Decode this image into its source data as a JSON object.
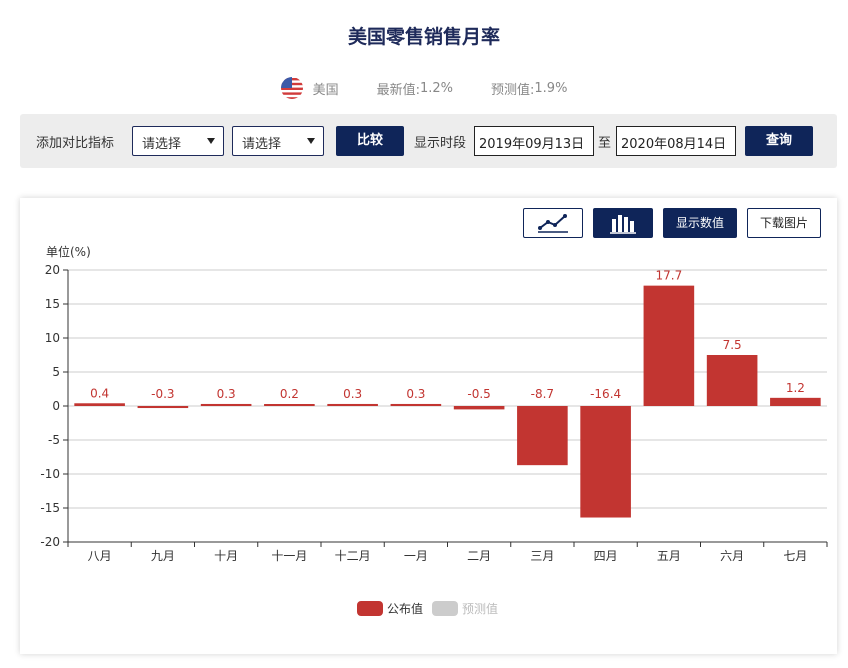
{
  "page": {
    "title": "美国零售销售月率"
  },
  "info": {
    "country": "美国",
    "latest_label": "最新值:",
    "latest_value": "1.2%",
    "forecast_label": "预测值:",
    "forecast_value": "1.9%"
  },
  "toolbar": {
    "compare_label": "添加对比指标",
    "select1": "请选择",
    "select2": "请选择",
    "compare_button": "比较",
    "period_label": "显示时段",
    "start_date": "2019年09月13日",
    "to_label": "至",
    "end_date": "2020年08月14日",
    "query_button": "查询"
  },
  "chart_controls": {
    "line_icon": "line-chart-icon",
    "bar_icon": "bar-chart-icon",
    "show_values": "显示数值",
    "download": "下载图片"
  },
  "colors": {
    "bar": "#c23531",
    "navy": "#0f2559",
    "forecast_legend": "#cccccc"
  },
  "chart_data": {
    "type": "bar",
    "unit_label": "单位(%)",
    "categories": [
      "八月",
      "九月",
      "十月",
      "十一月",
      "十二月",
      "一月",
      "二月",
      "三月",
      "四月",
      "五月",
      "六月",
      "七月"
    ],
    "series": [
      {
        "name": "公布值",
        "values": [
          0.4,
          -0.3,
          0.3,
          0.2,
          0.3,
          0.3,
          -0.5,
          -8.7,
          -16.4,
          17.7,
          7.5,
          1.2
        ]
      },
      {
        "name": "预测值",
        "values": []
      }
    ],
    "data_labels": [
      "0.4",
      "-0.3",
      "0.3",
      "0.2",
      "0.3",
      "0.3",
      "-0.5",
      "-8.7",
      "-16.4",
      "17.7",
      "7.5",
      "1.2"
    ],
    "ylim": [
      -20,
      20
    ],
    "yticks": [
      20,
      15,
      10,
      5,
      0,
      -5,
      -10,
      -15,
      -20
    ],
    "ytick_labels": [
      "20",
      "15",
      "10",
      "5",
      "0",
      "-5",
      "-10",
      "-15",
      "-20"
    ],
    "grid": true,
    "legend_position": "bottom-center"
  }
}
